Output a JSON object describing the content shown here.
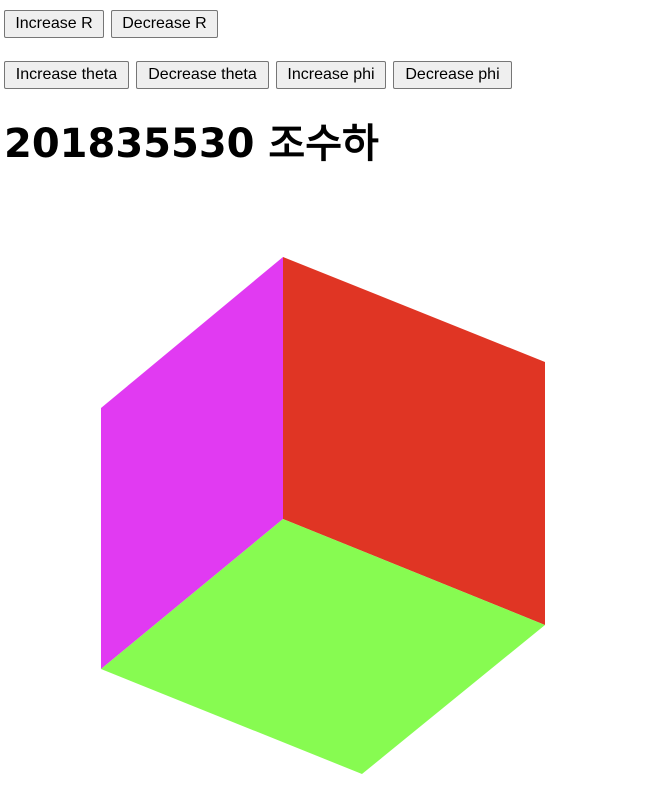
{
  "controls": {
    "radius": {
      "increase_label": "Increase R",
      "decrease_label": "Decrease R"
    },
    "angles": {
      "increase_theta_label": "Increase theta",
      "decrease_theta_label": "Decrease theta",
      "increase_phi_label": "Increase phi",
      "decrease_phi_label": "Decrease phi"
    }
  },
  "heading": {
    "text": "201835530 조수하"
  },
  "scene": {
    "faces": [
      {
        "name": "left-face",
        "color": "#e13af2"
      },
      {
        "name": "right-face",
        "color": "#e03524"
      },
      {
        "name": "bottom-face",
        "color": "#87fb51"
      }
    ]
  }
}
